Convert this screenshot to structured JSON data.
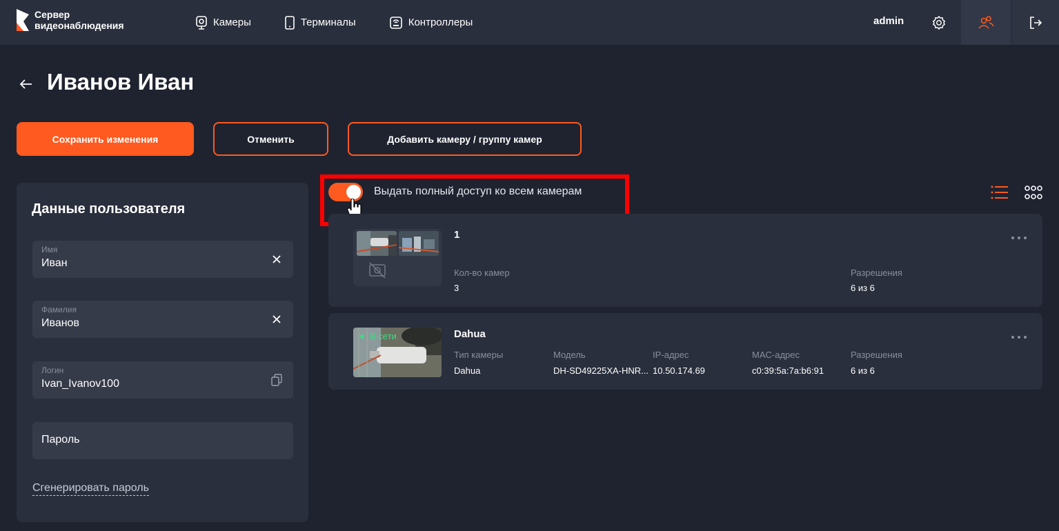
{
  "app": {
    "logo_line1": "Сервер",
    "logo_line2": "видеонаблюдения",
    "brand_color": "#ff5a1f"
  },
  "nav": {
    "items": [
      {
        "label": "Камеры",
        "icon": "camera-icon"
      },
      {
        "label": "Терминалы",
        "icon": "tablet-icon"
      },
      {
        "label": "Контроллеры",
        "icon": "controller-icon"
      }
    ],
    "user": "admin"
  },
  "page": {
    "title": "Иванов Иван"
  },
  "actions": {
    "save": "Сохранить изменения",
    "cancel": "Отменить",
    "add": "Добавить камеру / группу камер"
  },
  "user_panel": {
    "title": "Данные пользователя",
    "first_name_label": "Имя",
    "first_name": "Иван",
    "last_name_label": "Фамилия",
    "last_name": "Иванов",
    "login_label": "Логин",
    "login": "Ivan_Ivanov100",
    "password_placeholder": "Пароль",
    "generate_password": "Сгенерировать пароль"
  },
  "access": {
    "full_access_label": "Выдать полный доступ ко всем камерам",
    "full_access_enabled": true
  },
  "groups": [
    {
      "name": "1",
      "camera_count_label": "Кол-во камер",
      "camera_count": "3",
      "permissions_label": "Разрешения",
      "permissions": "6 из 6"
    }
  ],
  "cameras": [
    {
      "name": "Dahua",
      "status": "В сети",
      "status_color": "#3ddc84",
      "type_label": "Тип камеры",
      "type": "Dahua",
      "model_label": "Модель",
      "model": "DH-SD49225XA-HNR...",
      "ip_label": "IP-адрес",
      "ip": "10.50.174.69",
      "mac_label": "MAC-адрес",
      "mac": "c0:39:5a:7a:b6:91",
      "permissions_label": "Разрешения",
      "permissions": "6 из 6"
    }
  ]
}
